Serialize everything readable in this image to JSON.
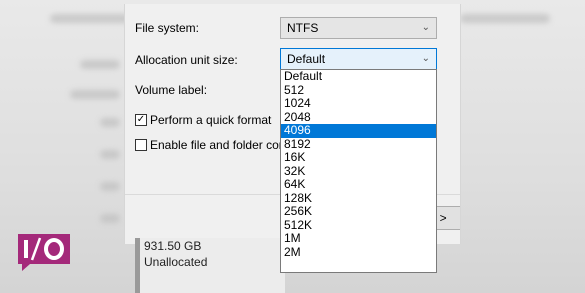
{
  "dialog": {
    "file_system_label": "File system:",
    "file_system_value": "NTFS",
    "alloc_label": "Allocation unit size:",
    "alloc_value": "Default",
    "volume_label": "Volume label:",
    "quick_format_label": "Perform a quick format",
    "quick_format_checked": true,
    "compress_label": "Enable file and folder con",
    "compress_checked": false,
    "next_label": "xt >"
  },
  "dropdown": {
    "options": [
      "Default",
      "512",
      "1024",
      "2048",
      "4096",
      "8192",
      "16K",
      "32K",
      "64K",
      "128K",
      "256K",
      "512K",
      "1M",
      "2M"
    ],
    "selected": "4096"
  },
  "disk": {
    "size": "931.50 GB",
    "status": "Unallocated"
  },
  "colors": {
    "accent": "#0078d7",
    "logo": "#a4297a"
  },
  "icons": [
    "chevron-down-icon",
    "check-icon",
    "logo-icon"
  ]
}
